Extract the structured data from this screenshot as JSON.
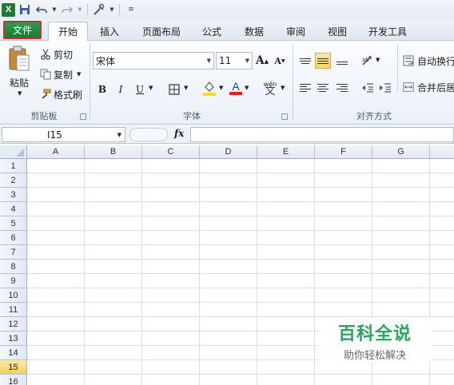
{
  "app": {
    "logo": "X",
    "quick_access": [
      "save-icon",
      "undo-icon",
      "redo-icon",
      "tools-icon",
      "customize-icon"
    ]
  },
  "tabs": [
    {
      "label": "文件",
      "active": false,
      "file": true
    },
    {
      "label": "开始",
      "active": true
    },
    {
      "label": "插入"
    },
    {
      "label": "页面布局"
    },
    {
      "label": "公式"
    },
    {
      "label": "数据"
    },
    {
      "label": "审阅"
    },
    {
      "label": "视图"
    },
    {
      "label": "开发工具"
    }
  ],
  "clipboard": {
    "paste_label": "粘贴",
    "cut_label": "剪切",
    "copy_label": "复制",
    "format_painter_label": "格式刷",
    "group_label": "剪贴板"
  },
  "font": {
    "font_name": "宋体",
    "font_size": "11",
    "bold": "B",
    "italic": "I",
    "underline": "U",
    "phonetic_label": "wén",
    "phonetic_char": "文",
    "group_label": "字体"
  },
  "alignment": {
    "wrap_text_label": "自动换行",
    "merge_center_label": "合并后居",
    "group_label": "对齐方式"
  },
  "formula_bar": {
    "name_box": "I15",
    "fx": "fx",
    "formula": ""
  },
  "grid": {
    "columns": [
      "A",
      "B",
      "C",
      "D",
      "E",
      "F",
      "G"
    ],
    "rows": [
      "1",
      "2",
      "3",
      "4",
      "5",
      "6",
      "7",
      "8",
      "9",
      "10",
      "11",
      "12",
      "13",
      "14",
      "15",
      "16"
    ],
    "active_row": "15"
  },
  "watermark": {
    "title": "百科全说",
    "subtitle": "助你轻松解决"
  },
  "colors": {
    "file_tab": "#1d7a35",
    "file_tab_border": "#c83232",
    "fill_color": "#ffe100",
    "font_color": "#e2231a",
    "watermark": "#2aa35d"
  }
}
